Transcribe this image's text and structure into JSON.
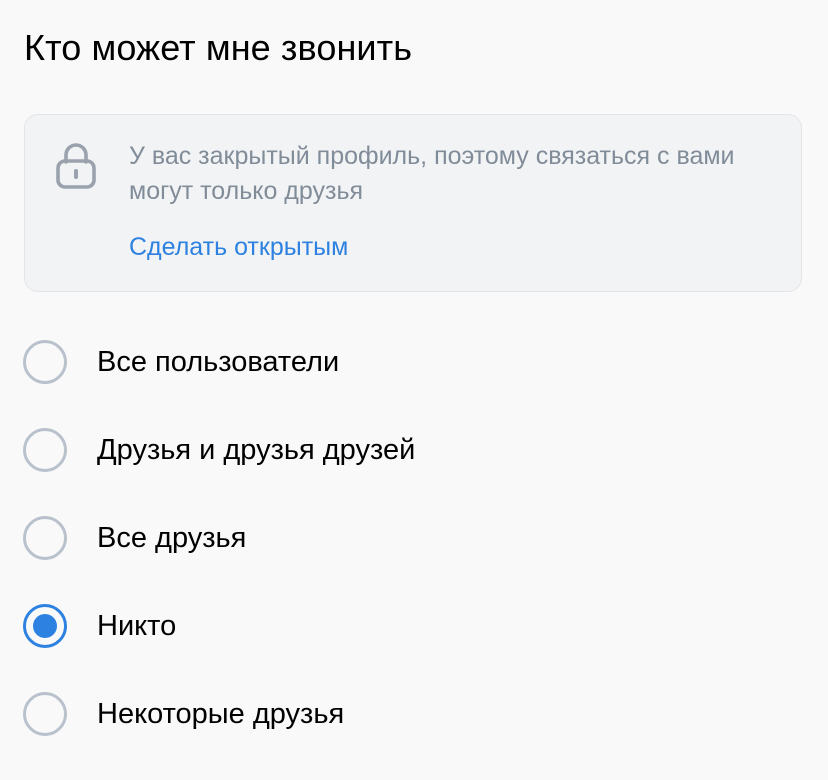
{
  "page": {
    "title": "Кто может мне звонить"
  },
  "notice": {
    "icon": "lock-icon",
    "text": "У вас закрытый профиль, поэтому связаться с вами могут только друзья",
    "link_label": "Сделать открытым"
  },
  "options": [
    {
      "label": "Все пользователи",
      "checked": false
    },
    {
      "label": "Друзья и друзья друзей",
      "checked": false
    },
    {
      "label": "Все друзья",
      "checked": false
    },
    {
      "label": "Никто",
      "checked": true
    },
    {
      "label": "Некоторые друзья",
      "checked": false
    }
  ],
  "colors": {
    "accent": "#2d81e0",
    "secondary_text": "#818c99",
    "radio_border": "#b8c1cc",
    "notice_background": "#f2f3f5",
    "page_background": "#f9f9fa"
  }
}
